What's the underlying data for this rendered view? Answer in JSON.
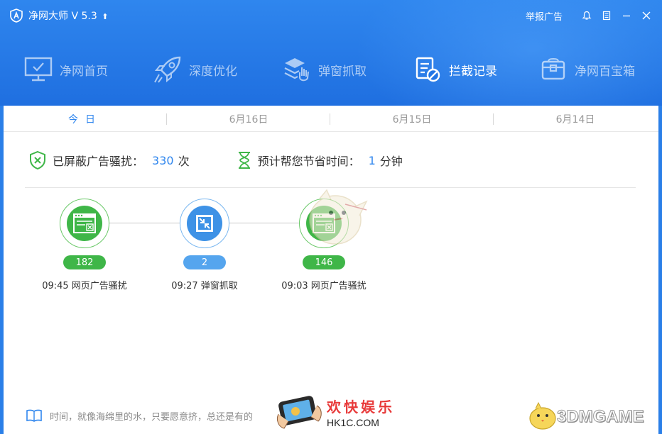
{
  "app": {
    "title": "净网大师 V 5.3"
  },
  "titlebar": {
    "report_label": "举报广告"
  },
  "nav": {
    "items": [
      {
        "label": "净网首页",
        "icon": "monitor-icon"
      },
      {
        "label": "深度优化",
        "icon": "rocket-icon"
      },
      {
        "label": "弹窗抓取",
        "icon": "popup-capture-icon"
      },
      {
        "label": "拦截记录",
        "icon": "block-record-icon"
      },
      {
        "label": "净网百宝箱",
        "icon": "toolbox-icon"
      }
    ],
    "active": "拦截记录"
  },
  "dates": {
    "today": "今日",
    "tabs": [
      "6月16日",
      "6月15日",
      "6月14日"
    ]
  },
  "stats": {
    "blocked_label": "已屏蔽广告骚扰：",
    "blocked_value": "330",
    "blocked_unit": "次",
    "saved_label": "预计帮您节省时间：",
    "saved_value": "1",
    "saved_unit": "分钟"
  },
  "timeline": [
    {
      "count": "182",
      "caption": "09:45 网页广告骚扰",
      "kind": "web-ad",
      "color": "#3fb648"
    },
    {
      "count": "2",
      "caption": "09:27 弹窗抓取",
      "kind": "popup",
      "color": "#3e92e6"
    },
    {
      "count": "146",
      "caption": "09:03 网页广告骚扰",
      "kind": "web-ad",
      "color": "#3fb648"
    }
  ],
  "footer": {
    "quote": "时间，就像海绵里的水，只要愿意挤，总还是有的"
  },
  "watermarks": {
    "left_title": "欢快娱乐",
    "left_url": "HK1C.COM",
    "right": "3DMGAME"
  },
  "colors": {
    "primary": "#2f86ee",
    "green": "#3fb648",
    "blue": "#3e92e6"
  }
}
